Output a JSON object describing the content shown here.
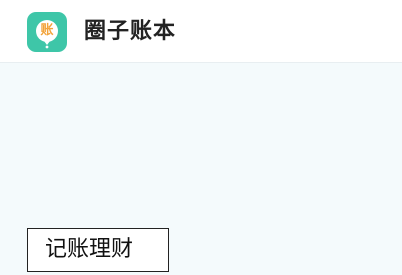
{
  "header": {
    "logo_icon": "ledger-balloon-logo-icon",
    "logo_char": "账",
    "app_name": "圈子账本"
  },
  "main": {
    "tag_label": "记账理财"
  },
  "colors": {
    "background": "#f4fafc",
    "header_bg": "#ffffff",
    "logo_bg": "#3ec6a8",
    "logo_accent": "#f2a33a",
    "title_text": "#222222"
  }
}
